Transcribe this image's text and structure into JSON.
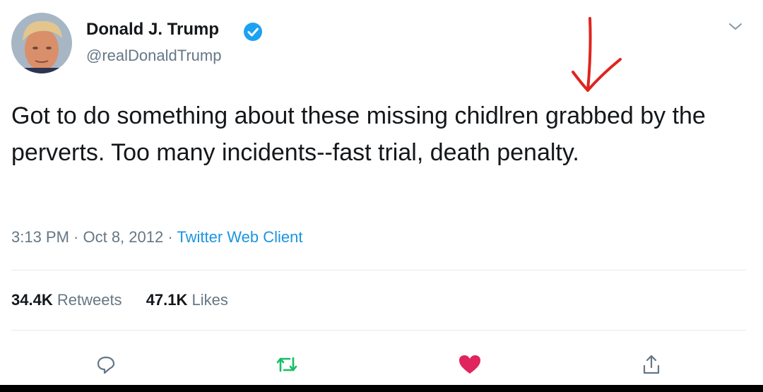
{
  "tweet": {
    "author": {
      "name": "Donald J. Trump",
      "handle": "@realDonaldTrump",
      "verified": true
    },
    "text": "Got to do something about these missing chidlren grabbed by the perverts. Too many incidents--fast trial, death penalty.",
    "timestamp": "3:13 PM · Oct 8, 2012 · ",
    "client": "Twitter Web Client",
    "stats": {
      "retweets_count": "34.4K",
      "retweets_label": "Retweets",
      "likes_count": "47.1K",
      "likes_label": "Likes"
    },
    "actions": [
      "reply-icon",
      "retweet-icon",
      "like-icon",
      "share-icon"
    ],
    "annotation": "red-arrow-pointing-at-chidlren"
  },
  "colors": {
    "text": "#14171a",
    "secondary": "#657786",
    "link": "#1b95e0",
    "verified": "#1da1f2",
    "retweet": "#17bf63",
    "like": "#e0245e",
    "annotation": "#e0241f",
    "divider": "#e6ecf0"
  }
}
